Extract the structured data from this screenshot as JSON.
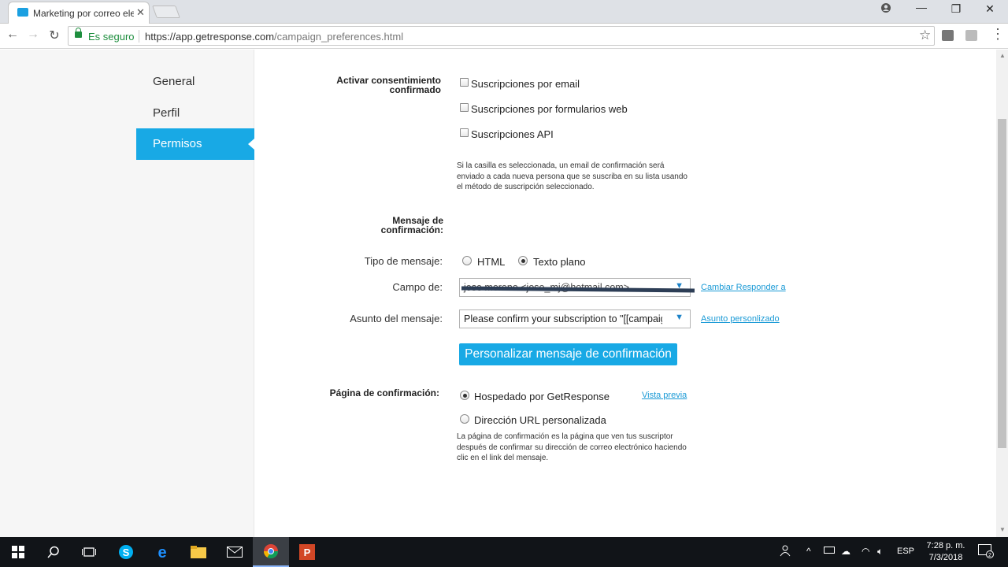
{
  "browser": {
    "tab_title": "Marketing por correo ele",
    "secure_label": "Es seguro",
    "url_host": "https://app.getresponse.com",
    "url_path": "/campaign_preferences.html"
  },
  "sidebar": {
    "items": [
      {
        "label": "General"
      },
      {
        "label": "Perfil"
      },
      {
        "label": "Permisos",
        "active": true
      }
    ]
  },
  "form": {
    "confirm_optin_label": "Activar consentimiento confirmado",
    "confirm_optin_label_l1": "Activar consentimiento",
    "confirm_optin_label_l2": "confirmado",
    "checkboxes": [
      {
        "label": "Suscripciones por email",
        "checked": false
      },
      {
        "label": "Suscripciones por formularios web",
        "checked": false
      },
      {
        "label": "Suscripciones API",
        "checked": false
      }
    ],
    "optin_help_l1": "Si la casilla es seleccionada, un email de confirmación será",
    "optin_help_l2": "enviado a cada nueva persona que se suscriba en su lista usando",
    "optin_help_l3": "el método de suscripción seleccionado.",
    "message_section_l1": "Mensaje de",
    "message_section_l2": "confirmación:",
    "message_type_label": "Tipo de mensaje:",
    "message_type_options": [
      {
        "label": "HTML",
        "selected": false
      },
      {
        "label": "Texto plano",
        "selected": true
      }
    ],
    "from_label": "Campo de:",
    "from_value": "jose moreno <jose_mj@hotmail.com>",
    "change_reply_link": "Cambiar Responder a",
    "subject_label": "Asunto del mensaje:",
    "subject_value": "Please confirm your subscription to \"[[campaign]",
    "custom_subject_link": "Asunto personlizado",
    "customize_button": "Personalizar mensaje de confirmación",
    "confirm_page_label": "Página de confirmación:",
    "confirm_page_options": [
      {
        "label": "Hospedado por GetResponse",
        "selected": true
      },
      {
        "label": "Dirección URL personalizada",
        "selected": false
      }
    ],
    "preview_link": "Vista previa",
    "page_help_l1": "La página de confirmación es la página que ven tus suscriptor",
    "page_help_l2": "después de confirmar su dirección de correo electrónico haciendo",
    "page_help_l3": "clic en el link del mensaje."
  },
  "taskbar": {
    "language": "ESP",
    "time": "7:28 p. m.",
    "date": "7/3/2018",
    "notifications": "2"
  },
  "colors": {
    "accent": "#18a9e5",
    "link": "#1a9ad6",
    "secure": "#1e8e3e"
  },
  "icons": [
    "mail-icon",
    "close-icon",
    "user-icon",
    "minimize-icon",
    "restore-icon",
    "back-icon",
    "forward-icon",
    "reload-icon",
    "lock-icon",
    "star-icon",
    "dropdown-arrow-icon",
    "windows-icon",
    "search-icon",
    "task-view-icon",
    "skype-icon",
    "edge-icon",
    "explorer-icon",
    "mail-app-icon",
    "chrome-icon",
    "powerpoint-icon"
  ]
}
